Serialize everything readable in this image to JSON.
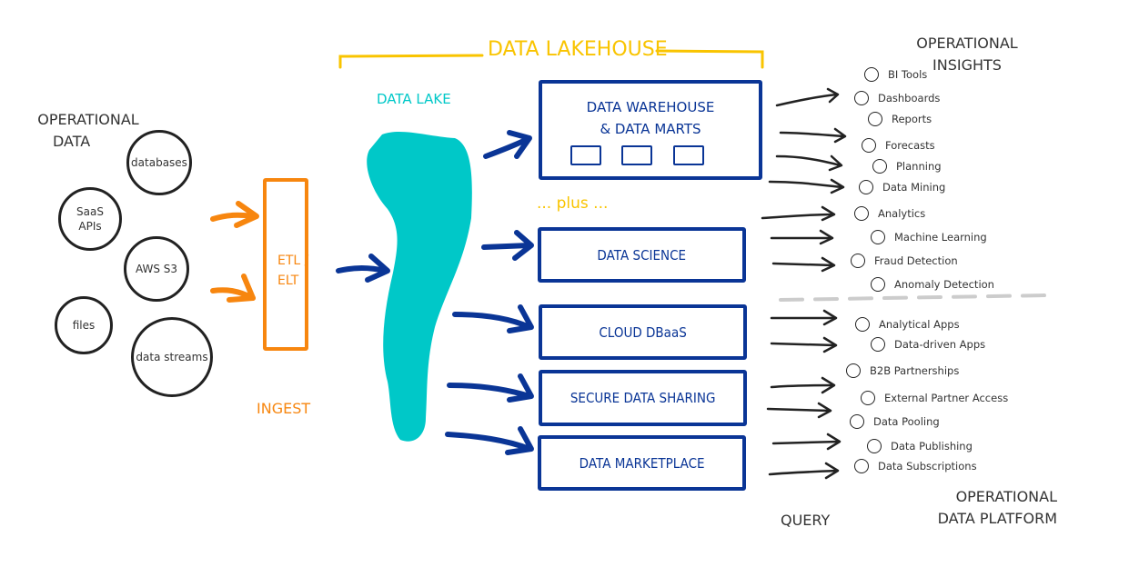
{
  "lakehouse": {
    "title": "DATA LAKEHOUSE",
    "data_lake_label": "DATA LAKE",
    "plus_label": "... plus ...",
    "colors": {
      "accent_yellow": "#f9c400",
      "lake_teal": "#00c8c8",
      "navy": "#0a3596",
      "ingest_orange": "#f7860f",
      "ink": "#222222"
    }
  },
  "operational_data": {
    "title_line1": "OPERATIONAL",
    "title_line2": "DATA",
    "sources": [
      {
        "label_line1": "databases",
        "label_line2": ""
      },
      {
        "label_line1": "SaaS",
        "label_line2": "APIs"
      },
      {
        "label_line1": "AWS S3",
        "label_line2": ""
      },
      {
        "label_line1": "files",
        "label_line2": ""
      },
      {
        "label_line1": "data streams",
        "label_line2": ""
      }
    ]
  },
  "ingest": {
    "etl_line1": "ETL /",
    "etl_line2": "ELT",
    "label": "INGEST"
  },
  "platforms": [
    {
      "label_line1": "DATA WAREHOUSE",
      "label_line2": "& DATA MARTS"
    },
    {
      "label_line1": "DATA SCIENCE",
      "label_line2": ""
    },
    {
      "label_line1": "CLOUD DBaaS",
      "label_line2": ""
    },
    {
      "label_line1": "SECURE DATA SHARING",
      "label_line2": ""
    },
    {
      "label_line1": "DATA MARKETPLACE",
      "label_line2": ""
    }
  ],
  "insights": {
    "title_line1": "OPERATIONAL",
    "title_line2": "INSIGHTS",
    "items": [
      "BI Tools",
      "Dashboards",
      "Reports",
      "Forecasts",
      "Planning",
      "Data Mining",
      "Analytics",
      "Machine Learning",
      "Fraud Detection",
      "Anomaly Detection"
    ]
  },
  "platform_outputs": {
    "title_line1": "OPERATIONAL",
    "title_line2": "DATA PLATFORM",
    "items": [
      "Analytical Apps",
      "Data-driven Apps",
      "B2B Partnerships",
      "External Partner Access",
      "Data Pooling",
      "Data Publishing",
      "Data Subscriptions"
    ]
  },
  "query_label": "QUERY"
}
